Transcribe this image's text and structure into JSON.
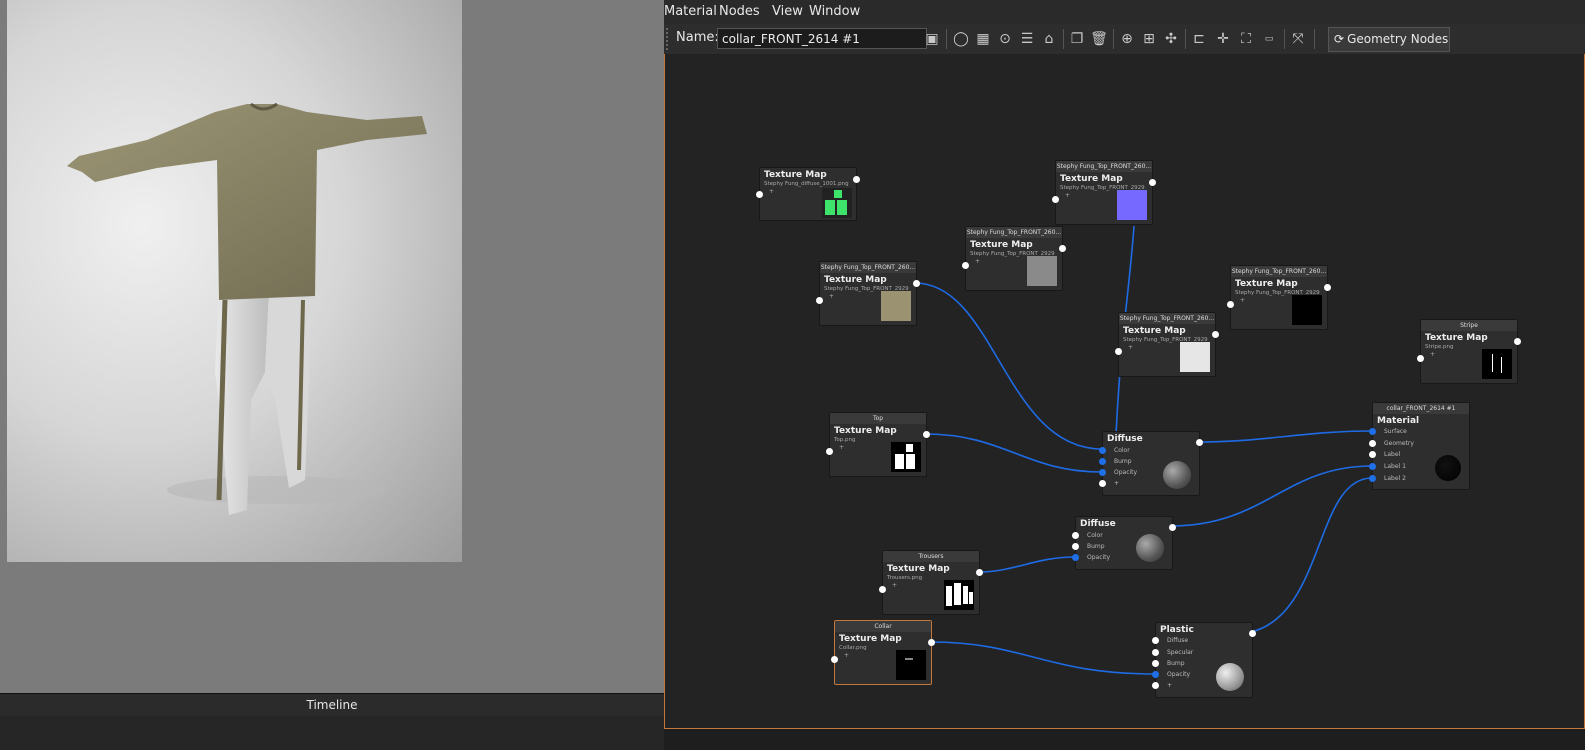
{
  "timeline_label": "Timeline",
  "menu": [
    "Material",
    "Nodes",
    "View",
    "Window"
  ],
  "toolbar": {
    "name_label": "Name:",
    "name_value": "collar_FRONT_2614 #1",
    "geometry_button": "Geometry Nodes"
  },
  "nodes": {
    "tm1": {
      "title": "Texture Map",
      "sub": "Stephy Fung_diffuse_1001.png",
      "plus": "+"
    },
    "tm2": {
      "header": "Stephy Fung_Top_FRONT_260...",
      "title": "Texture Map",
      "sub": "Stephy Fung_Top_FRONT_2929",
      "plus": "+"
    },
    "tm3": {
      "header": "Stephy Fung_Top_FRONT_260...",
      "title": "Texture Map",
      "sub": "Stephy Fung_Top_FRONT_2929",
      "plus": "+"
    },
    "tm4": {
      "header": "Stephy Fung_Top_FRONT_260...",
      "title": "Texture Map",
      "sub": "Stephy Fung_Top_FRONT_2929",
      "plus": "+"
    },
    "tm5": {
      "header": "Stephy Fung_Top_FRONT_260...",
      "title": "Texture Map",
      "sub": "Stephy Fung_Top_FRONT_2929",
      "plus": "+"
    },
    "tm6": {
      "header": "Stephy Fung_Top_FRONT_260...",
      "title": "Texture Map",
      "sub": "Stephy Fung_Top_FRONT_2929",
      "plus": "+"
    },
    "stripe": {
      "header": "Stripe",
      "title": "Texture Map",
      "sub": "Stripe.png",
      "plus": "+"
    },
    "top": {
      "header": "Top",
      "title": "Texture Map",
      "sub": "Top.png",
      "plus": "+"
    },
    "trousers": {
      "header": "Trousers",
      "title": "Texture Map",
      "sub": "Trousers.png",
      "plus": "+"
    },
    "collar": {
      "header": "Collar",
      "title": "Texture Map",
      "sub": "Collar.png",
      "plus": "+"
    },
    "diffuse1": {
      "title": "Diffuse",
      "inputs": [
        "Color",
        "Bump",
        "Opacity",
        "+"
      ]
    },
    "diffuse2": {
      "title": "Diffuse",
      "inputs": [
        "Color",
        "Bump",
        "Opacity"
      ]
    },
    "plastic": {
      "title": "Plastic",
      "inputs": [
        "Diffuse",
        "Specular",
        "Bump",
        "Opacity",
        "+"
      ]
    },
    "material": {
      "header": "collar_FRONT_2614 #1",
      "title": "Material",
      "inputs": [
        "Surface",
        "Geometry",
        "Label",
        "Label 1",
        "Label 2"
      ]
    }
  }
}
